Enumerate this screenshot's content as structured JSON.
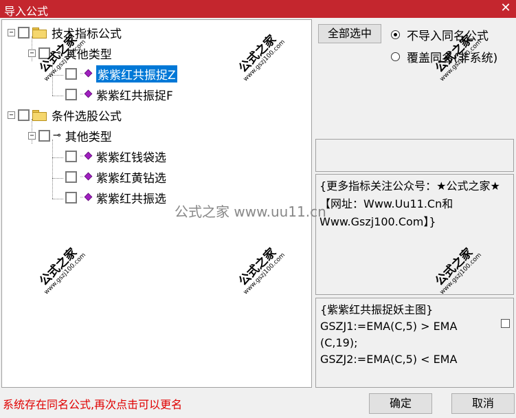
{
  "window": {
    "title": "导入公式",
    "close_glyph": "✕"
  },
  "tree": {
    "expand_glyph": "−",
    "nodes": [
      {
        "label": "技术指标公式",
        "icon": "folder-icon"
      },
      {
        "label": "其他类型",
        "icon": "key-icon"
      },
      {
        "label": "紫紫红共振捉Z",
        "icon": "gem-icon",
        "selected": true
      },
      {
        "label": "紫紫红共振捉F",
        "icon": "gem-icon"
      },
      {
        "label": "条件选股公式",
        "icon": "folder-icon"
      },
      {
        "label": "其他类型",
        "icon": "key-icon"
      },
      {
        "label": "紫紫红钱袋选",
        "icon": "gem-icon"
      },
      {
        "label": "紫紫红黄钻选",
        "icon": "gem-icon"
      },
      {
        "label": "紫紫红共振选",
        "icon": "gem-icon"
      }
    ]
  },
  "buttons": {
    "select_all": "全部选中",
    "ok": "确定",
    "cancel": "取消"
  },
  "options": {
    "no_import": "不导入同名公式",
    "overwrite": "覆盖同名(非系统)",
    "selected": "no_import"
  },
  "info": {
    "text": "{更多指标关注公众号：★公式之家★ 【网址：Www.Uu11.Cn和Www.Gszj100.Com】}"
  },
  "code": {
    "text": "{紫紫红共振捉妖主图}\nGSZJ1:=EMA(C,5) > EMA\n(C,19);\nGSZJ2:=EMA(C,5) < EMA"
  },
  "status": {
    "message": "系统存在同名公式,再次点击可以更名"
  },
  "watermarks": {
    "big": "公式之家",
    "small": "www.gszj100.com",
    "center": "公式之家 www.uu11.cn"
  },
  "colors": {
    "titlebar": "#c4262e",
    "selection": "#0078d7",
    "status": "#e00000",
    "gem": "#a020c0"
  }
}
